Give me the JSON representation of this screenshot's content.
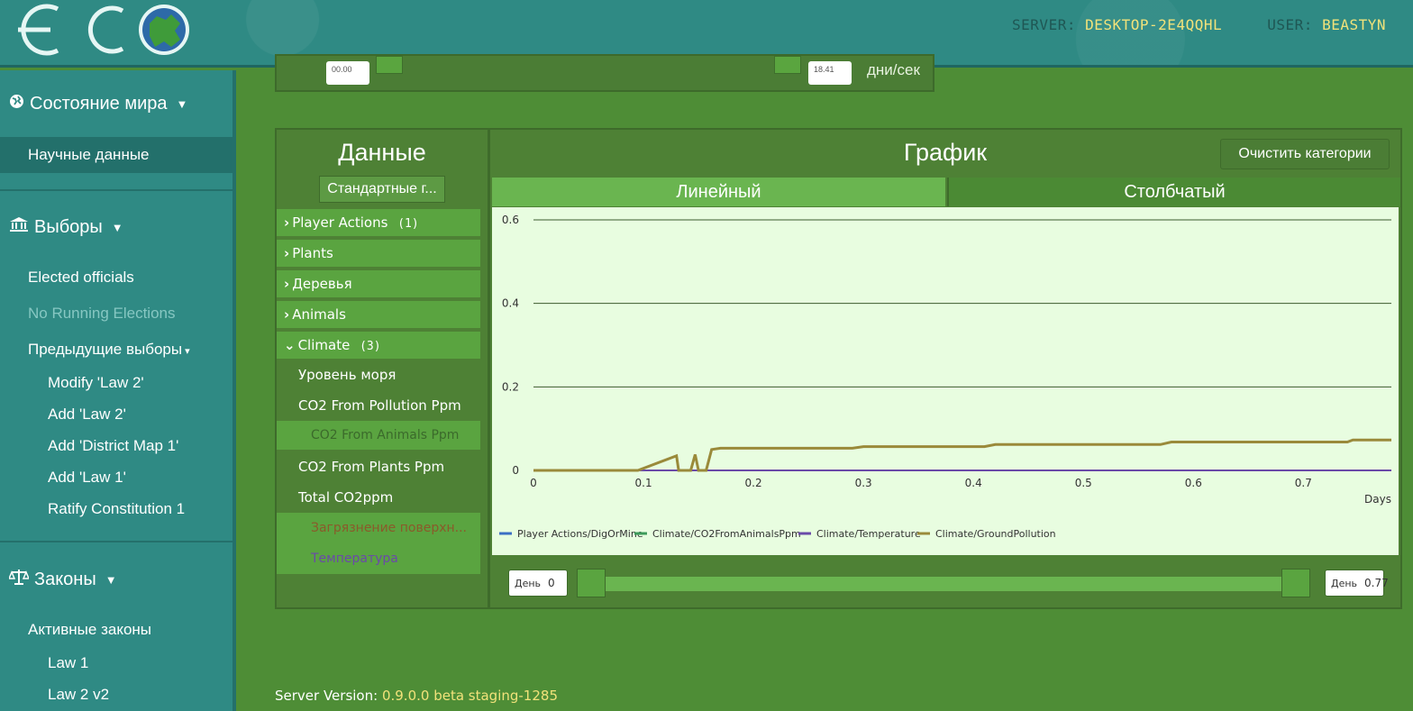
{
  "header": {
    "logo_text": "ECO",
    "server_label": "SERVER:",
    "server_value": "DESKTOP-2E4QQHL",
    "user_label": "USER:",
    "user_value": "BEASTYN"
  },
  "sidebar": {
    "world_state": "Состояние мира",
    "science_data": "Научные данные",
    "elections": "Выборы",
    "elected_officials": "Elected officials",
    "no_running": "No Running Elections",
    "previous_elections": "Предыдущие выборы",
    "previous_list": [
      "Modify 'Law 2'",
      "Add 'Law 2'",
      "Add 'District Map 1'",
      "Add 'Law 1'",
      "Ratify Constitution 1"
    ],
    "laws": "Законы",
    "active_laws": "Активные законы",
    "laws_list": [
      "Law 1",
      "Law 2 v2"
    ]
  },
  "top_strip": {
    "left_value": "00.00",
    "right_value": "18.41",
    "unit": "дни/сек"
  },
  "data_panel": {
    "title": "Данные",
    "standard_button": "Стандартные г...",
    "categories": [
      {
        "label": "Player Actions",
        "count": "(1)",
        "expanded": false
      },
      {
        "label": "Plants",
        "count": "",
        "expanded": false
      },
      {
        "label": "Деревья",
        "count": "",
        "expanded": false
      },
      {
        "label": "Animals",
        "count": "",
        "expanded": false
      },
      {
        "label": "Climate",
        "count": "(3)",
        "expanded": true
      }
    ],
    "climate_items": [
      "Уровень моря",
      "CO2 From Pollution Ppm",
      "CO2 From Animals Ppm",
      "CO2 From Plants Ppm",
      "Total CO2ppm",
      "Загрязнение поверхн...",
      "Температура"
    ]
  },
  "chart_panel": {
    "title": "График",
    "clear_button": "Очистить категории",
    "tab_line": "Линейный",
    "tab_bar": "Столбчатый",
    "range_label": "День",
    "range_start": "0",
    "range_end": "0.77"
  },
  "chart_data": {
    "type": "line",
    "xlabel": "Days",
    "ylabel": "",
    "xlim": [
      0,
      0.78
    ],
    "ylim": [
      0,
      0.6
    ],
    "x_ticks": [
      0,
      0.1,
      0.2,
      0.3,
      0.4,
      0.5,
      0.6,
      0.7
    ],
    "y_ticks": [
      0,
      0.2,
      0.4,
      0.6
    ],
    "x_tick_labels": [
      "0",
      "0.1",
      "0.2",
      "0.3",
      "0.4",
      "0.5",
      "0.6",
      "0.7"
    ],
    "y_tick_labels": [
      "0",
      "0.2",
      "0.4",
      "0.6"
    ],
    "grid": true,
    "legend_position": "bottom-left",
    "series": [
      {
        "name": "Player Actions/DigOrMine",
        "color": "#3b6fc4",
        "points": [
          [
            0,
            0
          ],
          [
            0.78,
            0
          ]
        ]
      },
      {
        "name": "Climate/CO2FromAnimalsPpm",
        "color": "#3c9a5a",
        "points": [
          [
            0,
            0
          ],
          [
            0.78,
            0
          ]
        ]
      },
      {
        "name": "Climate/Temperature",
        "color": "#6a4aa8",
        "points": [
          [
            0,
            0
          ],
          [
            0.78,
            0
          ]
        ]
      },
      {
        "name": "Climate/GroundPollution",
        "color": "#9a8a3a",
        "points": [
          [
            0,
            0
          ],
          [
            0.095,
            0
          ],
          [
            0.13,
            0.035
          ],
          [
            0.132,
            0
          ],
          [
            0.143,
            0
          ],
          [
            0.147,
            0.038
          ],
          [
            0.15,
            0
          ],
          [
            0.157,
            0
          ],
          [
            0.162,
            0.05
          ],
          [
            0.17,
            0.053
          ],
          [
            0.29,
            0.053
          ],
          [
            0.3,
            0.057
          ],
          [
            0.41,
            0.057
          ],
          [
            0.42,
            0.062
          ],
          [
            0.57,
            0.062
          ],
          [
            0.58,
            0.068
          ],
          [
            0.74,
            0.068
          ],
          [
            0.745,
            0.073
          ],
          [
            0.78,
            0.073
          ]
        ]
      }
    ]
  },
  "footer": {
    "label": "Server Version:",
    "version": "0.9.0.0 beta staging-1285"
  }
}
